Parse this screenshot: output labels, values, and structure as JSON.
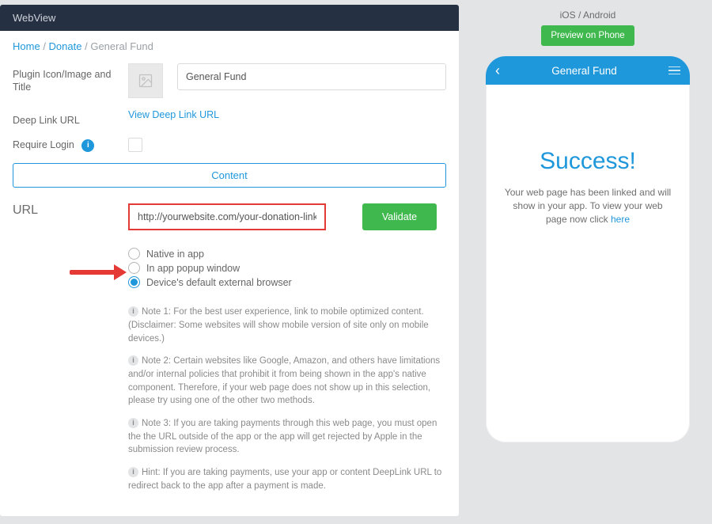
{
  "left": {
    "headerTitle": "WebView",
    "breadcrumb": {
      "home": "Home",
      "donate": "Donate",
      "current": "General Fund",
      "sep": " / "
    },
    "fields": {
      "pluginLabel": "Plugin Icon/Image and Title",
      "titleValue": "General Fund",
      "deepLinkLabel": "Deep Link URL",
      "deepLinkAction": "View Deep Link URL",
      "requireLoginLabel": "Require Login",
      "contentTab": "Content",
      "urlLabel": "URL",
      "urlValue": "http://yourwebsite.com/your-donation-link-here",
      "validateLabel": "Validate"
    },
    "radios": {
      "opt1": "Native in app",
      "opt2": "In app popup window",
      "opt3": "Device's default external browser"
    },
    "notes": {
      "n1": "Note 1: For the best user experience, link to mobile optimized content. (Disclaimer: Some websites will show mobile version of site only on mobile devices.)",
      "n2": "Note 2: Certain websites like Google, Amazon, and others have limitations and/or internal policies that prohibit it from being shown in the app's native component. Therefore, if your web page does not show up in this selection, please try using one of the other two methods.",
      "n3": "Note 3: If you are taking payments through this web page, you must open the the URL outside of the app or the app will get rejected by Apple in the submission review process.",
      "n4": "Hint: If you are taking payments, use your app or content DeepLink URL to redirect back to the app after a payment is made."
    }
  },
  "right": {
    "platform": "iOS / Android",
    "previewLabel": "Preview on Phone",
    "phoneTitle": "General Fund",
    "successTitle": "Success!",
    "successText": "Your web page has been linked and will show in your app. To view your web page now click ",
    "successLink": "here"
  }
}
